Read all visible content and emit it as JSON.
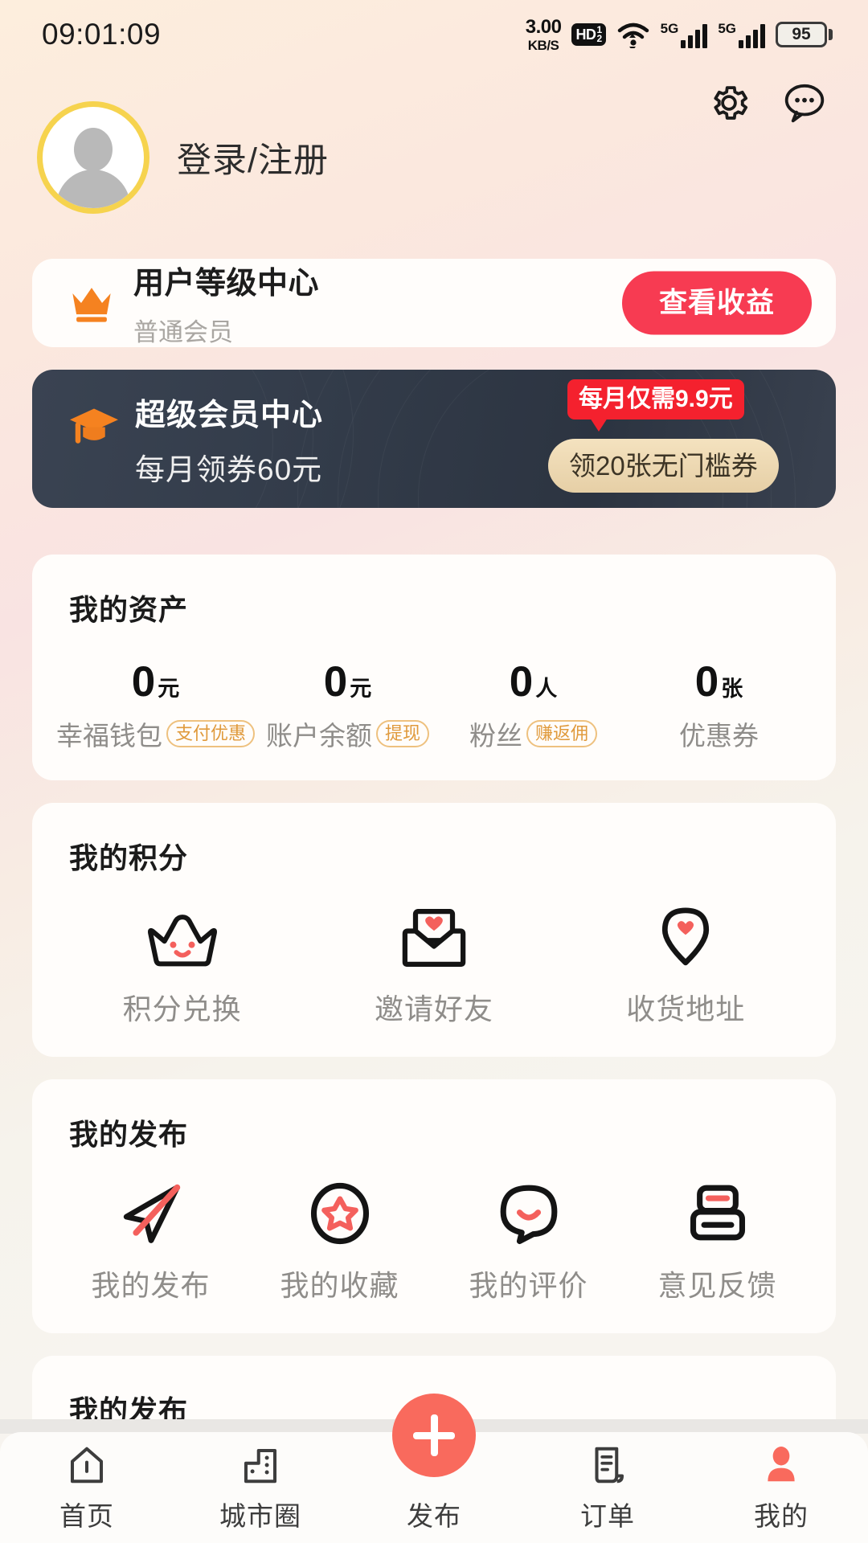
{
  "status_bar": {
    "time": "09:01:09",
    "net_speed_value": "3.00",
    "net_speed_unit": "KB/S",
    "hd_label": "HD",
    "hd_sup": "1",
    "hd_sub": "2",
    "wifi_icon": "wifi-icon",
    "signal_1_label": "5G",
    "signal_2_label": "5G",
    "battery_level": "95"
  },
  "profile": {
    "avatar_icon": "default-avatar-icon",
    "login_text": "登录/注册",
    "settings_icon": "gear-icon",
    "message_icon": "chat-bubble-icon"
  },
  "level_card": {
    "icon": "crown-icon",
    "title": "用户等级中心",
    "subtitle": "普通会员",
    "button_label": "查看收益",
    "button_color": "#f73b52"
  },
  "super_member": {
    "icon": "graduation-cap-icon",
    "title": "超级会员中心",
    "subtitle": "每月领券60元",
    "price_badge": "每月仅需9.9元",
    "price_badge_color": "#f4212e",
    "coupon_button": "领20张无门槛券",
    "coupon_button_color": "#e6cfa6",
    "background_color": "#333c4a"
  },
  "assets": {
    "title": "我的资产",
    "items": [
      {
        "value": "0",
        "unit": "元",
        "label": "幸福钱包",
        "tag": "支付优惠"
      },
      {
        "value": "0",
        "unit": "元",
        "label": "账户余额",
        "tag": "提现"
      },
      {
        "value": "0",
        "unit": "人",
        "label": "粉丝",
        "tag": "赚返佣"
      },
      {
        "value": "0",
        "unit": "张",
        "label": "优惠券",
        "tag": ""
      }
    ]
  },
  "points": {
    "title": "我的积分",
    "items": [
      {
        "icon": "crown-face-icon",
        "label": "积分兑换"
      },
      {
        "icon": "envelope-heart-icon",
        "label": "邀请好友"
      },
      {
        "icon": "location-pin-heart-icon",
        "label": "收货地址"
      }
    ]
  },
  "posts": {
    "title": "我的发布",
    "items": [
      {
        "icon": "paper-plane-icon",
        "label": "我的发布"
      },
      {
        "icon": "star-circle-icon",
        "label": "我的收藏"
      },
      {
        "icon": "speech-smile-icon",
        "label": "我的评价"
      },
      {
        "icon": "feedback-box-icon",
        "label": "意见反馈"
      }
    ]
  },
  "posts_secondary": {
    "title": "我的发布"
  },
  "bottom_nav": {
    "items": [
      {
        "icon": "home-icon",
        "label": "首页",
        "active": false
      },
      {
        "icon": "building-icon",
        "label": "城市圈",
        "active": false
      },
      {
        "icon": "plus-publish-icon",
        "label": "发布",
        "active": false
      },
      {
        "icon": "receipt-icon",
        "label": "订单",
        "active": false
      },
      {
        "icon": "person-icon",
        "label": "我的",
        "active": true
      }
    ],
    "active_color": "#f96a5d"
  }
}
